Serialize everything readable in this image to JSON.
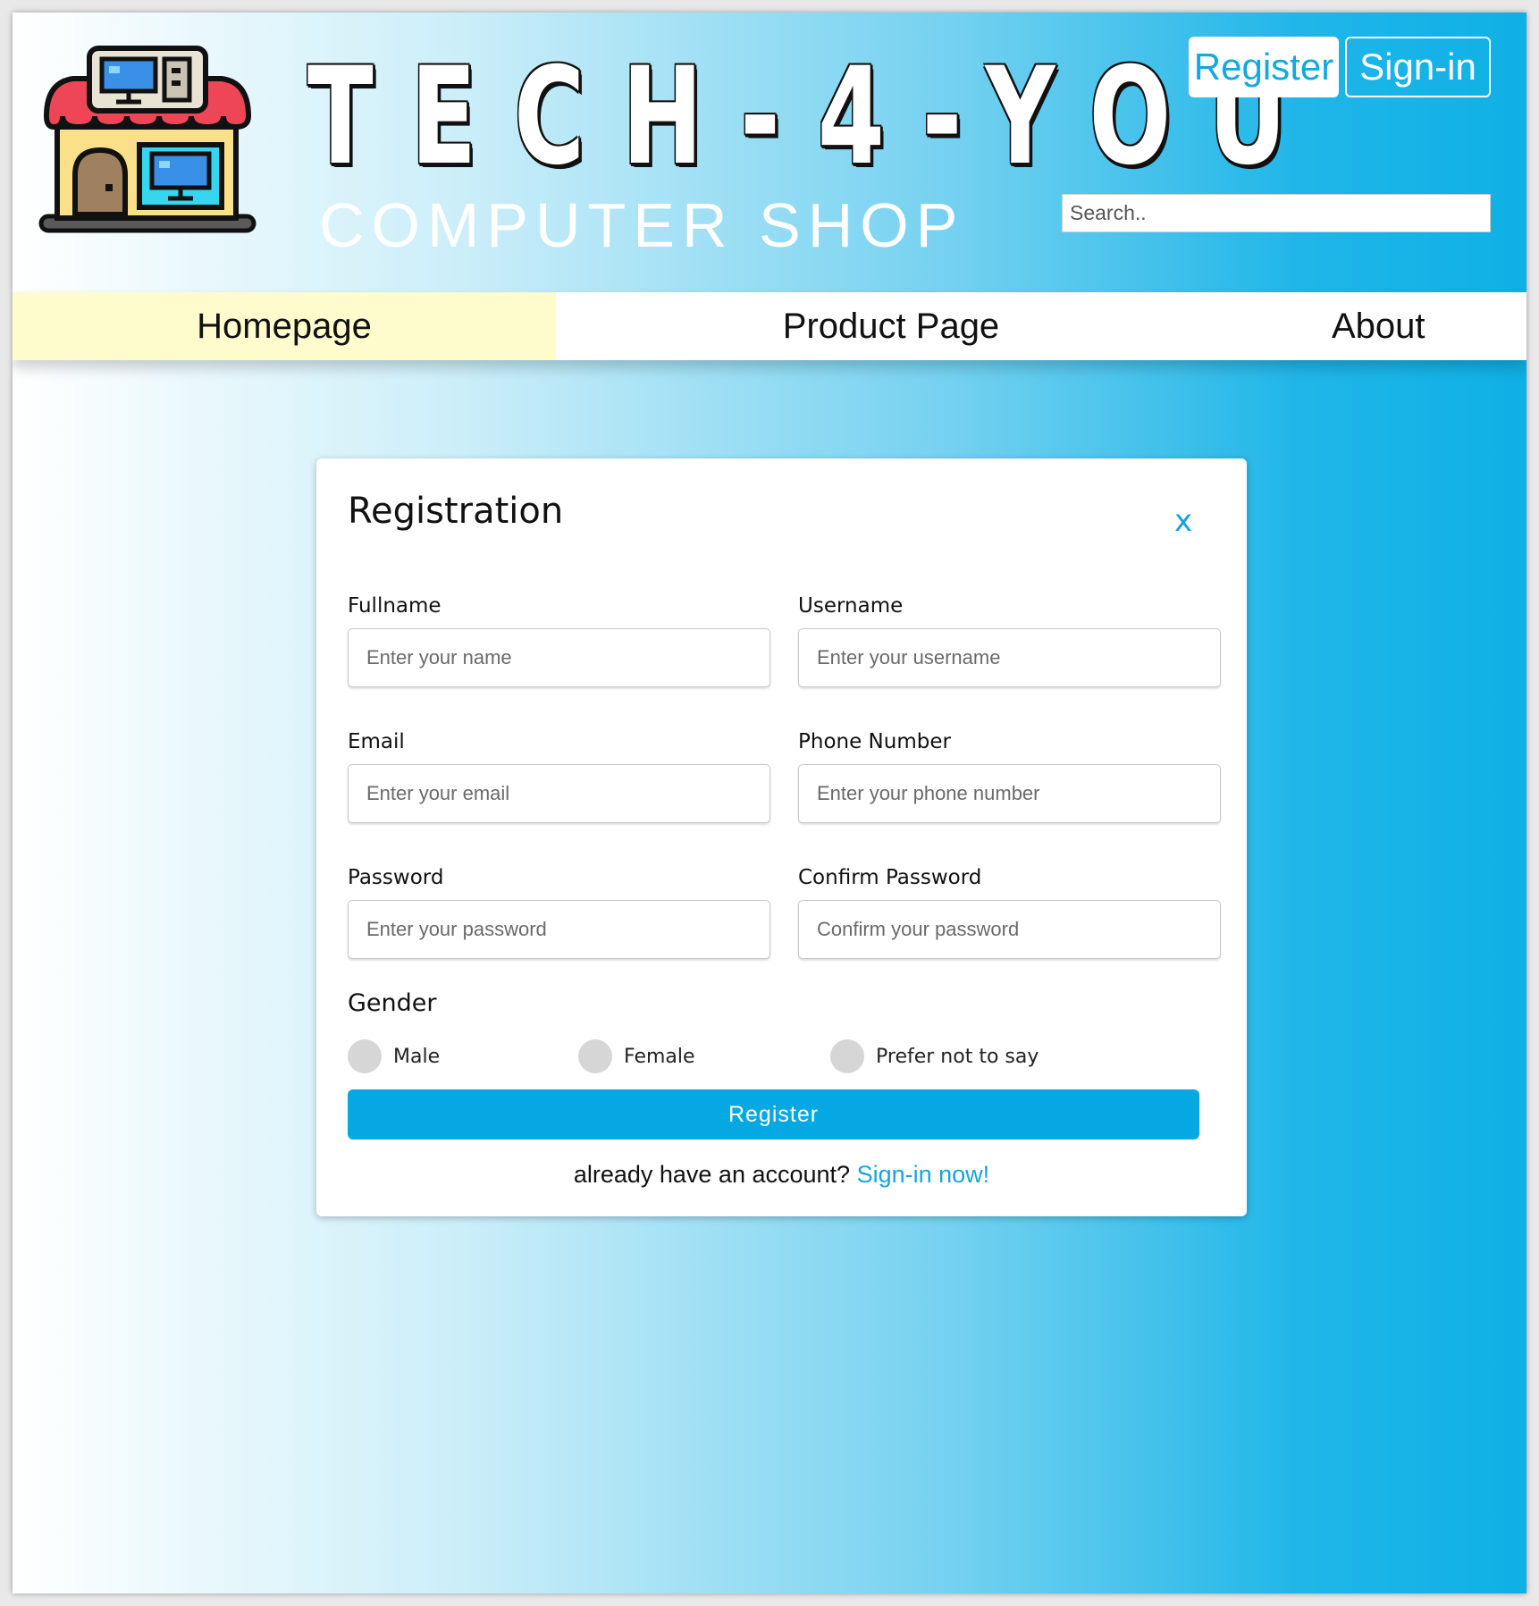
{
  "brand": {
    "title": "TECH-4-YOU",
    "subtitle": "COMPUTER SHOP",
    "logo_icon": "computer-shop-storefront-icon"
  },
  "header": {
    "register_label": "Register",
    "signin_label": "Sign-in",
    "search_placeholder": "Search.."
  },
  "nav": {
    "items": [
      {
        "label": "Homepage",
        "active": true
      },
      {
        "label": "Product Page",
        "active": false
      },
      {
        "label": "About",
        "active": false
      }
    ]
  },
  "modal": {
    "title": "Registration",
    "close_label": "x",
    "fields": [
      {
        "label": "Fullname",
        "placeholder": "Enter your name"
      },
      {
        "label": "Username",
        "placeholder": "Enter your username"
      },
      {
        "label": "Email",
        "placeholder": "Enter your email"
      },
      {
        "label": "Phone Number",
        "placeholder": "Enter your phone number"
      },
      {
        "label": "Password",
        "placeholder": "Enter your password"
      },
      {
        "label": "Confirm Password",
        "placeholder": "Confirm your password"
      }
    ],
    "gender": {
      "label": "Gender",
      "options": [
        "Male",
        "Female",
        "Prefer not to say"
      ]
    },
    "submit_label": "Register",
    "signin_prompt": "already have an account?",
    "signin_link": "Sign-in now!"
  },
  "colors": {
    "accent": "#05a8e2",
    "nav_active_bg": "#fefccc",
    "link": "#1aa3d9"
  }
}
